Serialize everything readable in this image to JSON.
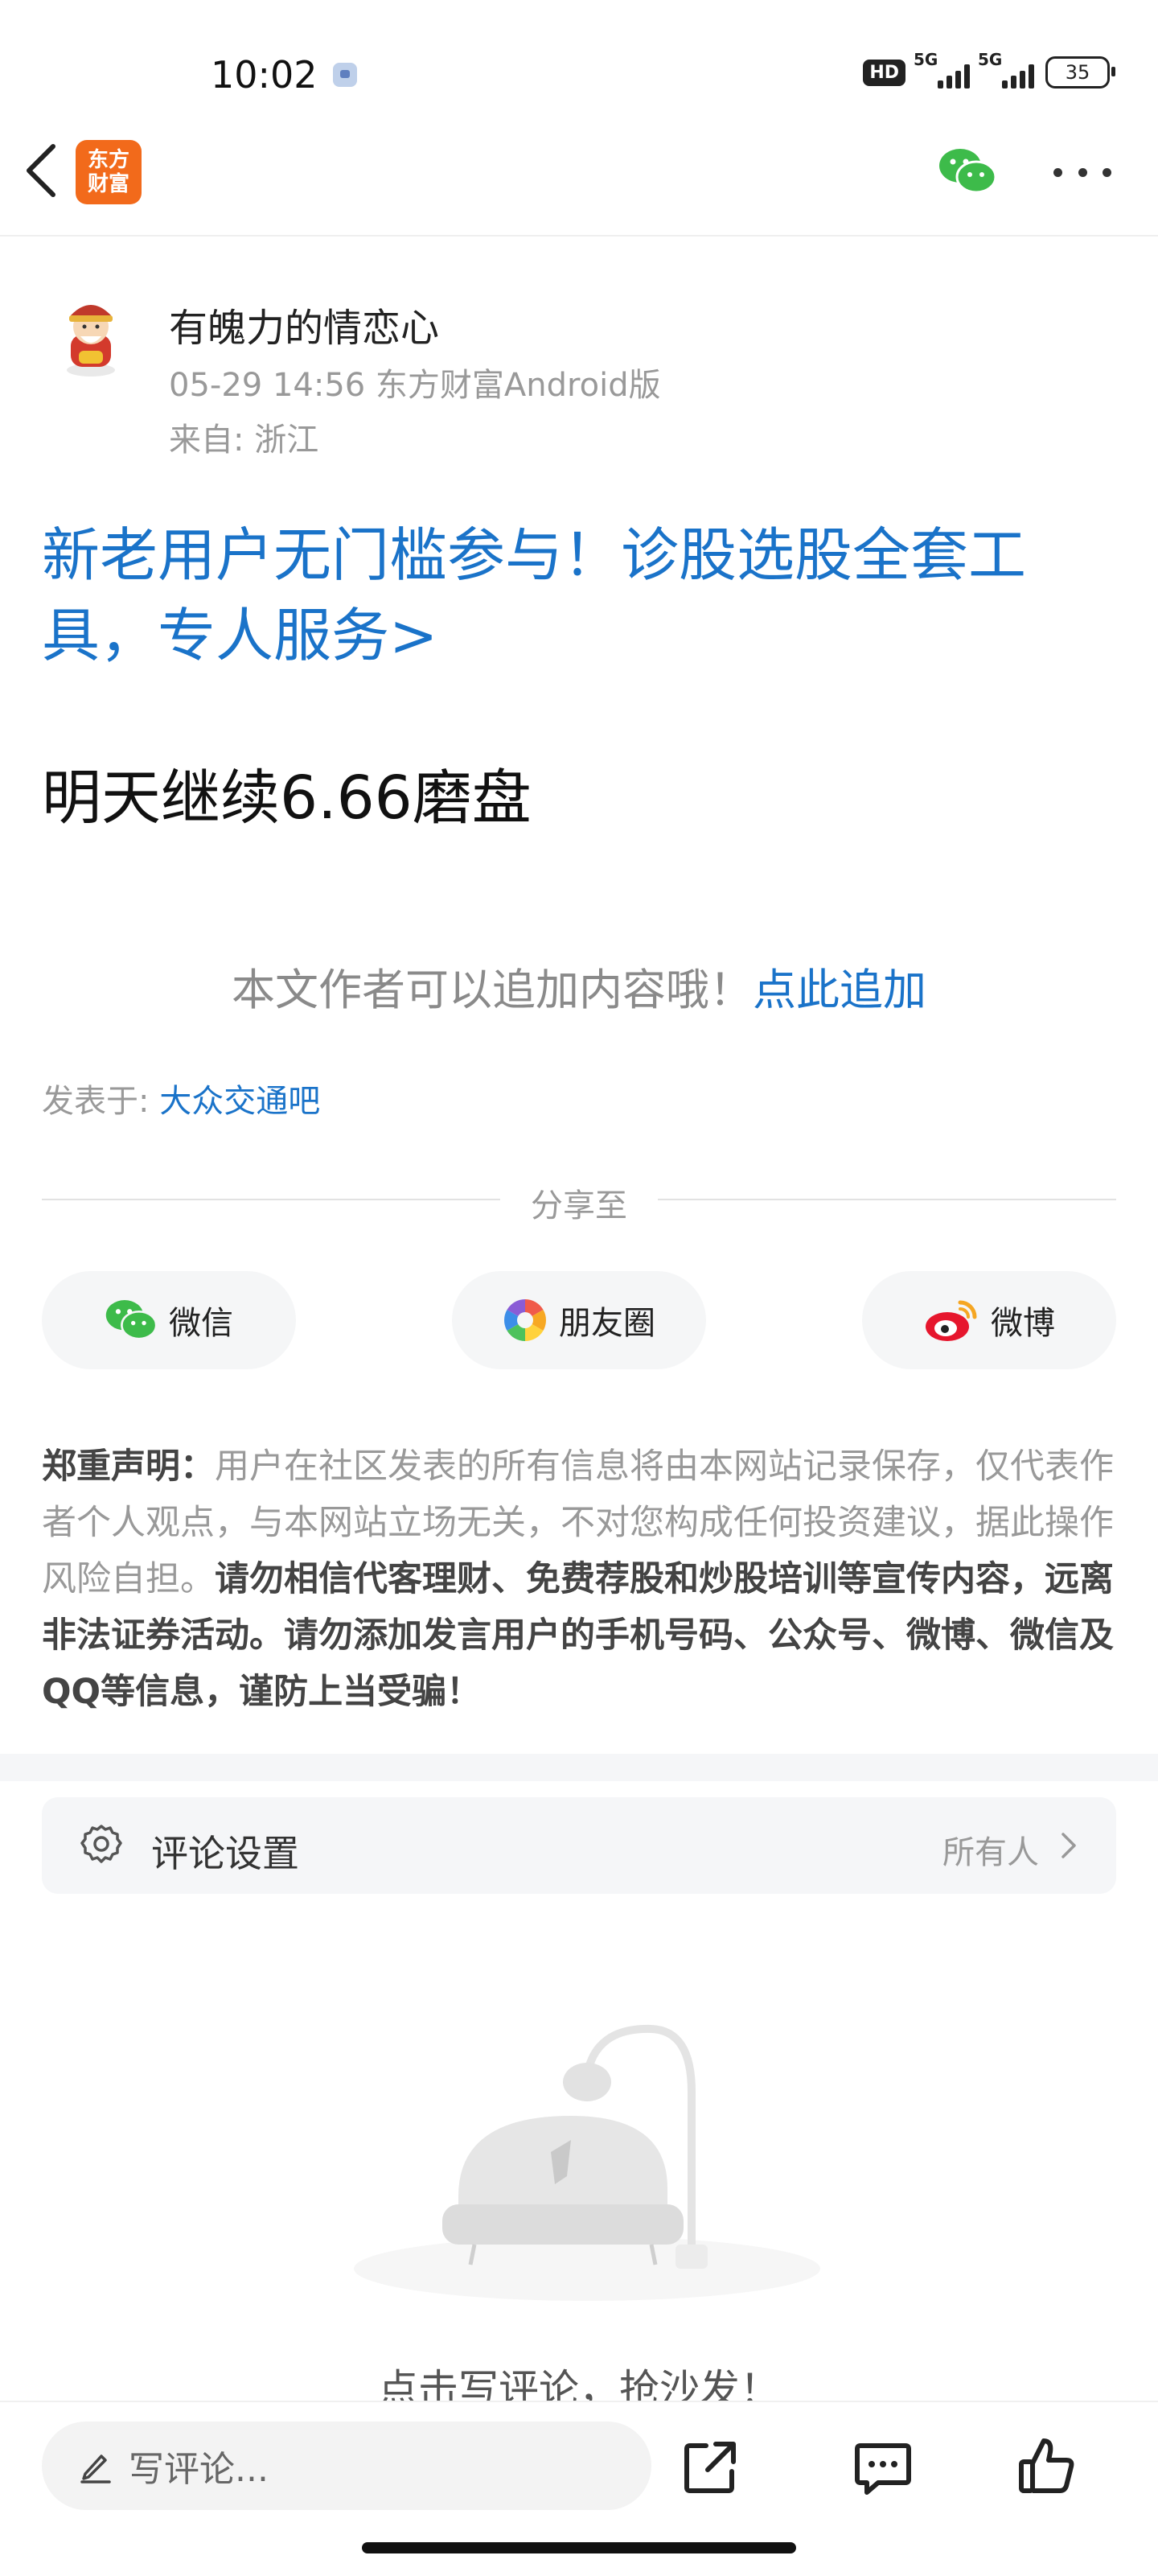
{
  "status_bar": {
    "time": "10:02",
    "hd": "HD",
    "signal1": "5G",
    "signal2": "5G",
    "battery": "35"
  },
  "header": {
    "logo_line1": "东方",
    "logo_line2": "财富"
  },
  "post": {
    "author": "有魄力的情恋心",
    "meta": "05-29 14:56 东方财富Android版",
    "from": "来自: 浙江",
    "promo": "新老用户无门槛参与！诊股选股全套工具，专人服务>",
    "content": "明天继续6.66磨盘",
    "append_prompt": "本文作者可以追加内容哦！",
    "append_link": "点此追加",
    "posted_in_label": "发表于: ",
    "posted_in_bar": "大众交通吧"
  },
  "share": {
    "title": "分享至",
    "wechat": "微信",
    "moments": "朋友圈",
    "weibo": "微博"
  },
  "disclaimer": {
    "title": "郑重声明：",
    "normal": "用户在社区发表的所有信息将由本网站记录保存，仅代表作者个人观点，与本网站立场无关，不对您构成任何投资建议，据此操作风险自担。",
    "strong": "请勿相信代客理财、免费荐股和炒股培训等宣传内容，远离非法证券活动。请勿添加发言用户的手机号码、公众号、微博、微信及QQ等信息，谨防上当受骗！"
  },
  "comment_settings": {
    "label": "评论设置",
    "value": "所有人"
  },
  "empty": {
    "text": "点击写评论，抢沙发！"
  },
  "bottom": {
    "placeholder": "写评论..."
  }
}
